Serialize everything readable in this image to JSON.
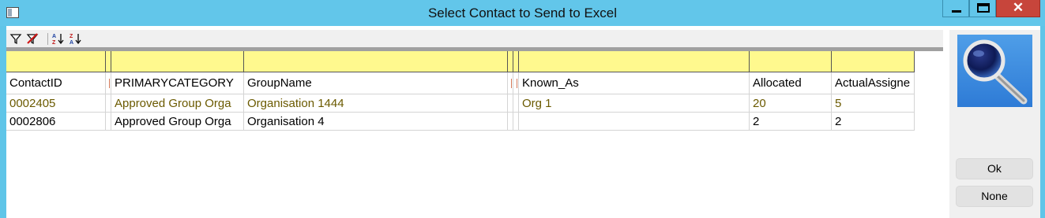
{
  "window": {
    "title": "Select Contact to Send to Excel",
    "close_glyph": "✕"
  },
  "toolbar": {
    "icons": [
      "filter-icon",
      "clear-filter-icon",
      "sort-ascending-icon",
      "sort-descending-icon"
    ]
  },
  "grid": {
    "columns": [
      "ContactID",
      "",
      "PRIMARYCATEGORY",
      "GroupName",
      "",
      "",
      "Known_As",
      "Allocated",
      "ActualAssigne"
    ],
    "rows": [
      [
        "0002405",
        "",
        "Approved Group Orga",
        "Organisation 1444",
        "",
        "",
        "Org 1",
        "20",
        "5"
      ],
      [
        "0002806",
        "",
        "Approved Group Orga",
        "Organisation 4",
        "",
        "",
        "",
        "2",
        "2"
      ]
    ]
  },
  "side_panel": {
    "search_icon": "magnifier-icon",
    "ok_label": "Ok",
    "none_label": "None"
  },
  "colors": {
    "title_bar": "#62c6ea",
    "filter_row": "#fff98e",
    "selected_row": "#fffcc0",
    "selected_text": "#6b5a00",
    "close_button": "#c7453b"
  }
}
